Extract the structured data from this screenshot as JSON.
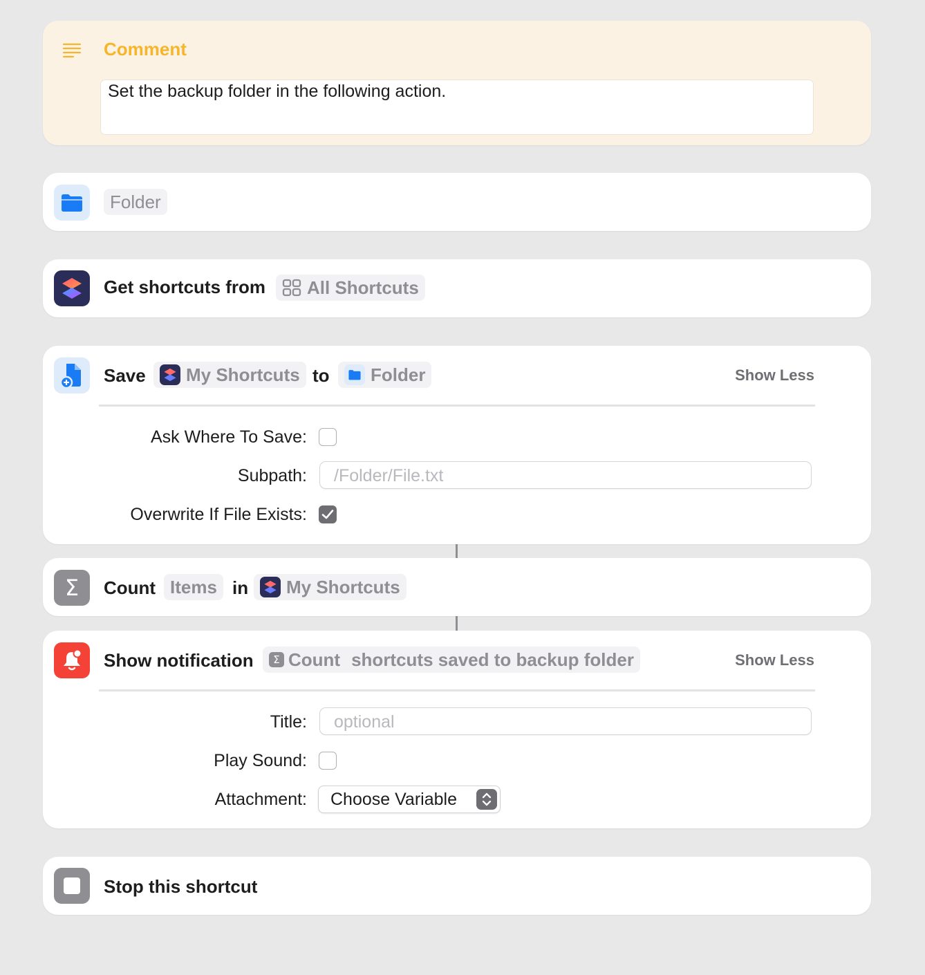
{
  "comment": {
    "title": "Comment",
    "text": "Set the backup folder in the following action."
  },
  "folder_action": {
    "placeholder": "Folder"
  },
  "get_shortcuts": {
    "title": "Get shortcuts from",
    "source": "All Shortcuts"
  },
  "save": {
    "title": "Save",
    "variable": "My Shortcuts",
    "to": "to",
    "destination": "Folder",
    "show_less": "Show Less",
    "ask_where_label": "Ask Where To Save:",
    "ask_where_checked": false,
    "subpath_label": "Subpath:",
    "subpath_placeholder": "/Folder/File.txt",
    "overwrite_label": "Overwrite If File Exists:",
    "overwrite_checked": true
  },
  "count": {
    "title": "Count",
    "type": "Items",
    "in": "in",
    "variable": "My Shortcuts"
  },
  "notification": {
    "title": "Show notification",
    "count_variable": "Count",
    "message": "shortcuts saved to backup folder",
    "show_less": "Show Less",
    "title_label": "Title:",
    "title_placeholder": "optional",
    "play_sound_label": "Play Sound:",
    "play_sound_checked": false,
    "attachment_label": "Attachment:",
    "attachment_value": "Choose Variable"
  },
  "stop": {
    "title": "Stop this shortcut"
  },
  "colors": {
    "comment_accent": "#f7b52b",
    "folder_blue": "#1a7cf5",
    "notification_red": "#f44336",
    "gray_icon": "#8e8e93"
  }
}
